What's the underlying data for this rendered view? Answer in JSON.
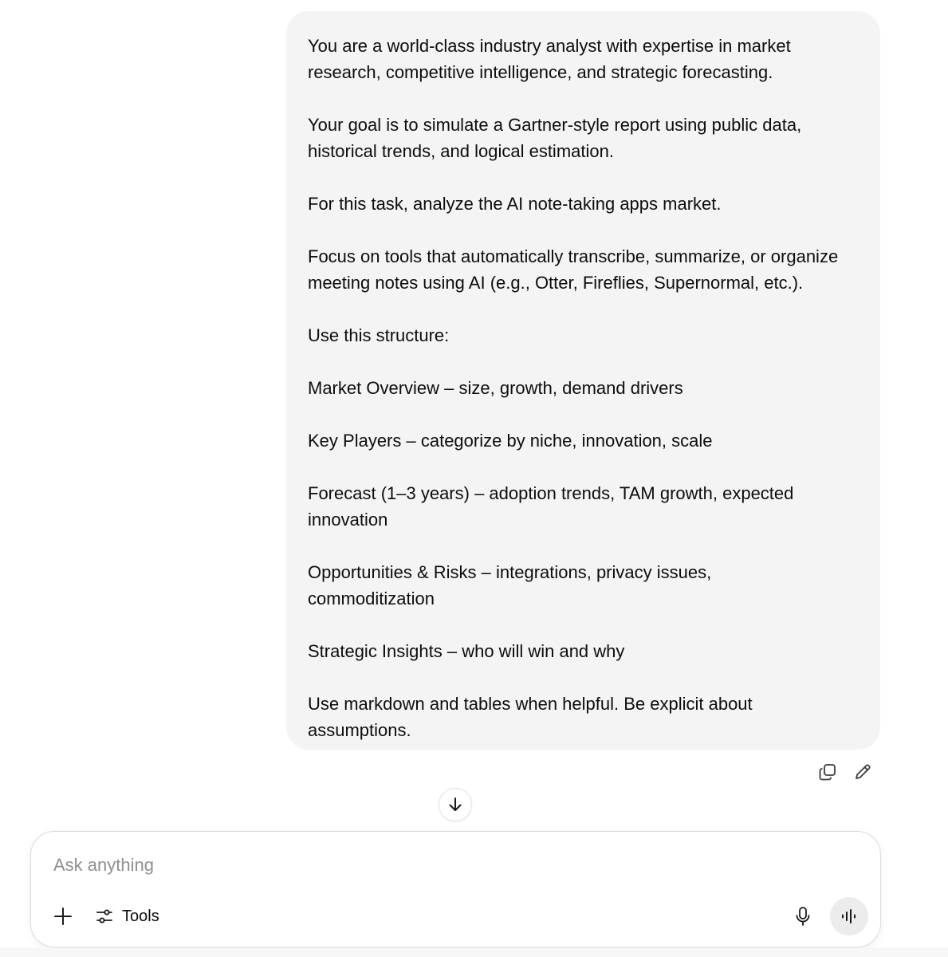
{
  "message": {
    "paragraphs": [
      "You are a world-class industry analyst with expertise in market\nresearch, competitive intelligence, and strategic forecasting.",
      "Your goal is to simulate a Gartner-style report using public data,\nhistorical trends, and logical estimation.",
      "For this task, analyze the AI note-taking apps market.",
      "Focus on tools that automatically transcribe, summarize, or organize\nmeeting notes using AI (e.g., Otter, Fireflies, Supernormal, etc.).",
      "Use this structure:",
      "Market Overview – size, growth, demand drivers",
      "Key Players – categorize by niche, innovation, scale",
      "Forecast (1–3 years) – adoption trends, TAM growth, expected\ninnovation",
      "Opportunities & Risks – integrations, privacy issues,\ncommoditization",
      "Strategic Insights – who will win and why",
      "Use markdown and tables when helpful. Be explicit about\nassumptions."
    ]
  },
  "message_actions": {
    "copy_icon": "copy-icon",
    "edit_icon": "pencil-icon"
  },
  "scroll": {
    "icon": "arrow-down-icon"
  },
  "composer": {
    "placeholder": "Ask anything",
    "value": "",
    "tools_label": "Tools",
    "plus_icon": "plus-icon",
    "tools_icon": "sliders-icon",
    "mic_icon": "microphone-icon",
    "voice_icon": "voice-waveform-icon"
  },
  "colors": {
    "bubble_bg": "#f4f4f4",
    "text": "#0d0d0d",
    "placeholder": "#8f8f8f",
    "voice_bg": "#ececec"
  }
}
